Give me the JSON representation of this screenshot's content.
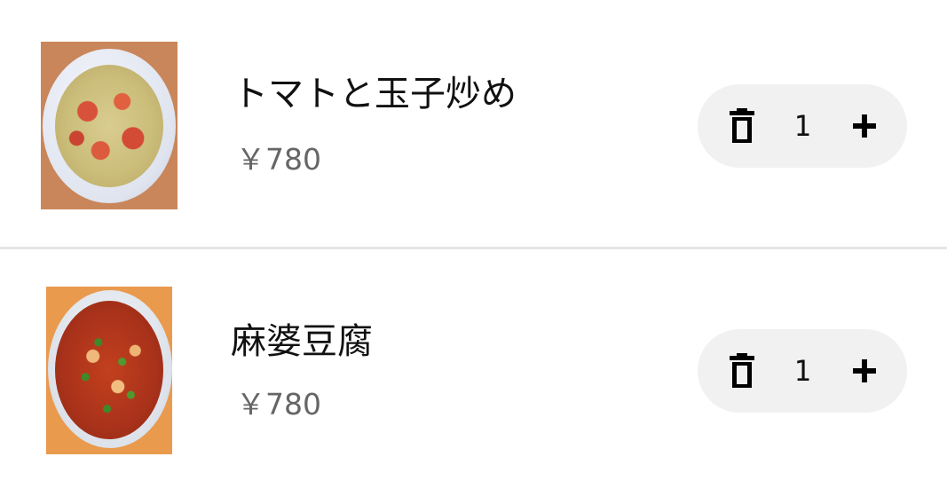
{
  "cart": {
    "items": [
      {
        "name": "トマトと玉子炒め",
        "price": "￥780",
        "quantity": "1",
        "image_icon": "tomato-egg-stir-fry-photo",
        "delete_icon": "trash-icon",
        "increment_icon": "plus-icon"
      },
      {
        "name": "麻婆豆腐",
        "price": "￥780",
        "quantity": "1",
        "image_icon": "mapo-tofu-photo",
        "delete_icon": "trash-icon",
        "increment_icon": "plus-icon"
      }
    ]
  },
  "colors": {
    "background": "#ffffff",
    "divider": "#e6e6e6",
    "stepper_background": "#f1f1f1",
    "name_text": "#111111",
    "price_text": "#666666"
  }
}
